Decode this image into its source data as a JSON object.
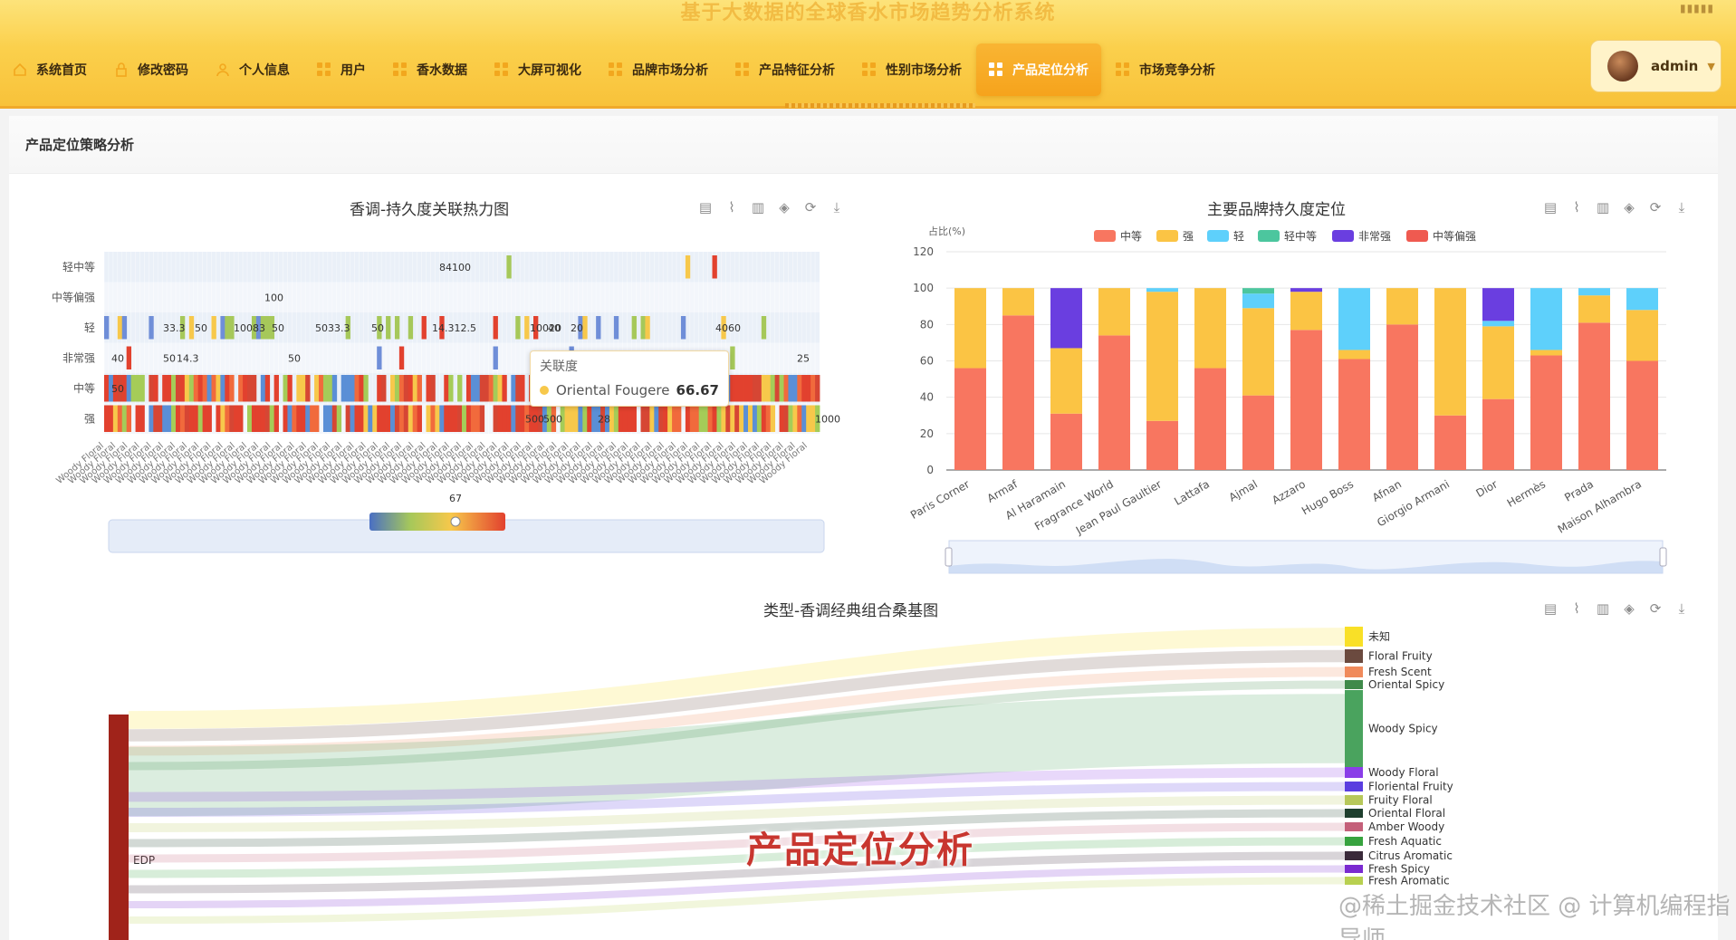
{
  "header": {
    "system_title": "基于大数据的全球香水市场趋势分析系统",
    "window_dots": "▮▮▮▮▮",
    "nav": [
      {
        "label": "系统首页",
        "icon": "home-icon"
      },
      {
        "label": "修改密码",
        "icon": "lock-icon"
      },
      {
        "label": "个人信息",
        "icon": "user-icon"
      },
      {
        "label": "用户",
        "icon": "grid-icon"
      },
      {
        "label": "香水数据",
        "icon": "grid-icon"
      },
      {
        "label": "大屏可视化",
        "icon": "grid-icon"
      },
      {
        "label": "品牌市场分析",
        "icon": "grid-icon"
      },
      {
        "label": "产品特征分析",
        "icon": "grid-icon"
      },
      {
        "label": "性别市场分析",
        "icon": "grid-icon"
      },
      {
        "label": "产品定位分析",
        "icon": "grid-icon",
        "active": true
      },
      {
        "label": "市场竞争分析",
        "icon": "grid-icon"
      }
    ],
    "user": {
      "name": "admin"
    }
  },
  "page": {
    "title": "产品定位策略分析",
    "overlay_title": "产品定位分析",
    "watermark": "@稀土掘金技术社区 @ 计算机编程指导师"
  },
  "toolbox_icons": [
    "data-view-icon",
    "line-icon",
    "bar-icon",
    "stack-icon",
    "refresh-icon",
    "download-icon"
  ],
  "colors": {
    "accent": "#f6a31c",
    "zhongdeng": "#f87660",
    "qiang": "#fbc444",
    "qing": "#5ed0fb",
    "qingzhongdeng": "#4cc69e",
    "feichangqiang": "#6a3ee0",
    "zhongdengpianqiang": "#ef5a50"
  },
  "chart_data": [
    {
      "type": "heatmap",
      "title": "香调-持久度关联热力图",
      "y_categories": [
        "强",
        "中等",
        "非常强",
        "轻",
        "中等偏强",
        "轻中等"
      ],
      "visible_labels": {
        "轻中等": [
          "84100"
        ],
        "中等偏强": [
          "100"
        ],
        "轻": [
          "33.3",
          "50",
          "10083",
          "50",
          "5033.3",
          "50",
          "14.312.5",
          "10020",
          "40",
          "20",
          "4060"
        ],
        "非常强": [
          "40",
          "50",
          "14.3",
          "50",
          "25"
        ],
        "中等": [
          "50"
        ],
        "强": [
          "500",
          "1000",
          "28",
          "500"
        ]
      },
      "tooltip": {
        "header": "关联度",
        "name": "Oriental Fougere",
        "value": 66.67
      },
      "visual_map_marker": "67"
    },
    {
      "type": "bar",
      "stacked": true,
      "title": "主要品牌持久度定位",
      "ylabel": "占比(%)",
      "ylim": [
        0,
        120
      ],
      "yticks": [
        0,
        20,
        40,
        60,
        80,
        100,
        120
      ],
      "legend_position": "top-center",
      "categories": [
        "Paris Corner",
        "Armaf",
        "Al Haramain",
        "Fragrance World",
        "Jean Paul Gaultier",
        "Lattafa",
        "Ajmal",
        "Azzaro",
        "Hugo Boss",
        "Afnan",
        "Giorgio Armani",
        "Dior",
        "Hermès",
        "Prada",
        "Maison Alhambra"
      ],
      "series": [
        {
          "name": "中等",
          "color": "#f87660",
          "values": [
            56,
            85,
            31,
            74,
            27,
            56,
            41,
            77,
            61,
            80,
            30,
            39,
            63,
            81,
            60
          ]
        },
        {
          "name": "强",
          "color": "#fbc444",
          "values": [
            44,
            15,
            36,
            26,
            71,
            44,
            48,
            21,
            5,
            20,
            70,
            40,
            3,
            15,
            28
          ]
        },
        {
          "name": "轻",
          "color": "#5ed0fb",
          "values": [
            0,
            0,
            0,
            0,
            2,
            0,
            8,
            0,
            34,
            0,
            0,
            3,
            34,
            4,
            12
          ]
        },
        {
          "name": "轻中等",
          "color": "#4cc69e",
          "values": [
            0,
            0,
            0,
            0,
            0,
            0,
            3,
            0,
            0,
            0,
            0,
            0,
            0,
            0,
            0
          ]
        },
        {
          "name": "非常强",
          "color": "#6a3ee0",
          "values": [
            0,
            0,
            33,
            0,
            0,
            0,
            0,
            2,
            0,
            0,
            0,
            18,
            0,
            0,
            0
          ]
        },
        {
          "name": "中等偏强",
          "color": "#ef5a50",
          "values": [
            0,
            0,
            0,
            0,
            0,
            0,
            0,
            0,
            0,
            0,
            0,
            0,
            0,
            0,
            0
          ]
        }
      ]
    },
    {
      "type": "sankey",
      "title": "类型-香调经典组合桑基图",
      "source_nodes": [
        {
          "name": "EDP",
          "color": "#a0231a"
        }
      ],
      "target_nodes": [
        {
          "name": "未知",
          "color": "#f9e027"
        },
        {
          "name": "Floral Fruity",
          "color": "#6b4a3f"
        },
        {
          "name": "Fresh Scent",
          "color": "#f08a5b"
        },
        {
          "name": "Oriental Spicy",
          "color": "#3f8a4a"
        },
        {
          "name": "Woody Spicy",
          "color": "#4aa35e"
        },
        {
          "name": "Woody Floral",
          "color": "#8a3ee8"
        },
        {
          "name": "Floriental Fruity",
          "color": "#5a3ee0"
        },
        {
          "name": "Fruity Floral",
          "color": "#b7c85a"
        },
        {
          "name": "Oriental Floral",
          "color": "#1e3f2e"
        },
        {
          "name": "Amber Woody",
          "color": "#c4607a"
        },
        {
          "name": "Fresh Aquatic",
          "color": "#37a33f"
        },
        {
          "name": "Citrus Aromatic",
          "color": "#3a2a3a"
        },
        {
          "name": "Fresh Spicy",
          "color": "#7a2ad0"
        },
        {
          "name": "Fresh Aromatic",
          "color": "#b8d050"
        }
      ]
    }
  ]
}
